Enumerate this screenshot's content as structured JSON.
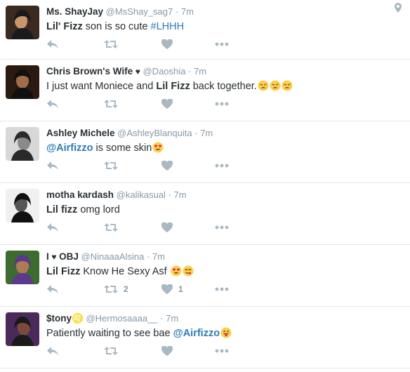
{
  "tweets": [
    {
      "name": "Ms. ShayJay",
      "name_heart": false,
      "handle": "@MsShay_sag7",
      "time": "7m",
      "text": [
        {
          "t": "Lil' Fizz",
          "b": true
        },
        {
          "t": " son is so cute "
        },
        {
          "t": "#LHHH",
          "link": true
        }
      ],
      "emojis": [],
      "retweets": "",
      "likes": "",
      "avatar_colors": [
        "#3b2a20",
        "#c9966b",
        "#1a1a1a"
      ]
    },
    {
      "name": "Chris Brown's Wife",
      "name_heart": true,
      "handle": "@Daoshia",
      "time": "7m",
      "text": [
        {
          "t": "I just want Moniece and "
        },
        {
          "t": "Lil Fizz",
          "b": true
        },
        {
          "t": " back together."
        }
      ],
      "emojis": [
        "weary-face",
        "weary-face",
        "weary-face"
      ],
      "retweets": "",
      "likes": "",
      "avatar_colors": [
        "#2a1a12",
        "#a06c4a",
        "#101010"
      ]
    },
    {
      "name": "Ashley Michele",
      "name_heart": false,
      "handle": "@AshleyBlanquita",
      "time": "7m",
      "text": [
        {
          "t": "@Airfizzo",
          "link": true,
          "b": true
        },
        {
          "t": " is some skin"
        }
      ],
      "emojis": [
        "heart-eyes"
      ],
      "retweets": "",
      "likes": "",
      "avatar_colors": [
        "#d8d8d8",
        "#8a8a8a",
        "#2a2a2a"
      ]
    },
    {
      "name": "motha kardash",
      "name_heart": false,
      "handle": "@kalikasual",
      "time": "7m",
      "text": [
        {
          "t": "Lil fizz",
          "b": true
        },
        {
          "t": " omg lord"
        }
      ],
      "emojis": [],
      "retweets": "",
      "likes": "",
      "avatar_colors": [
        "#f0f0f0",
        "#555555",
        "#111111"
      ]
    },
    {
      "name": "I",
      "name_heart": true,
      "name_suffix": "OBJ",
      "handle": "@NinaaaAlsina",
      "time": "7m",
      "text": [
        {
          "t": "Lil Fizz",
          "b": true
        },
        {
          "t": " Know He Sexy Asf "
        }
      ],
      "emojis": [
        "heart-eyes",
        "yum-face"
      ],
      "retweets": "2",
      "likes": "1",
      "avatar_colors": [
        "#3e6b2f",
        "#b07a5a",
        "#5a3a8a"
      ]
    },
    {
      "name": "$tony♌",
      "name_heart": false,
      "handle": "@Hermosaaaa__",
      "time": "7m",
      "text": [
        {
          "t": "Patiently waiting to see bae "
        },
        {
          "t": "@Airfizzo",
          "link": true,
          "b": true
        }
      ],
      "emojis": [
        "tongue-face"
      ],
      "retweets": "",
      "likes": "",
      "avatar_colors": [
        "#4a2a5a",
        "#7a4a3a",
        "#1a1a1a"
      ]
    }
  ],
  "icons": {
    "geo": "map-pin-icon",
    "reply": "reply-icon",
    "retweet": "retweet-icon",
    "like": "heart-icon",
    "more": "more-icon"
  },
  "colors": {
    "link": "#2b7bb9",
    "muted": "#8899a6",
    "action": "#aab8c2",
    "divider": "#e1e8ed"
  }
}
